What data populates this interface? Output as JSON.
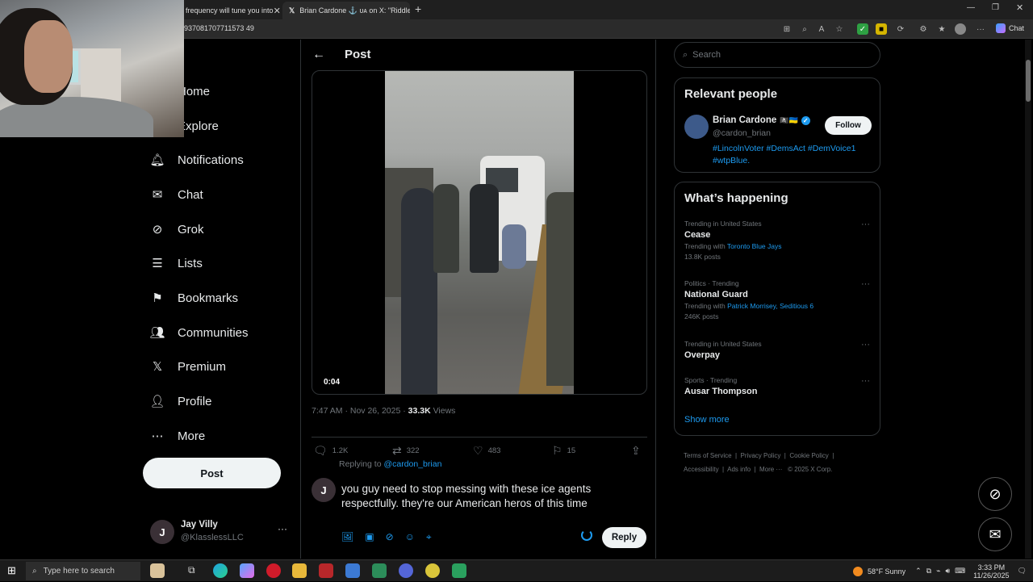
{
  "browser": {
    "tabs": [
      {
        "title": "frequency will tune you into",
        "active": false
      },
      {
        "title": "Brian Cardone ⚓ ᴜᴀ on X: \"Riddle",
        "active": true
      }
    ],
    "url": "937081707711573 49"
  },
  "nav": {
    "items": [
      {
        "label": "Home",
        "icon": "home-icon"
      },
      {
        "label": "Explore",
        "icon": "explore-icon"
      },
      {
        "label": "Notifications",
        "icon": "bell-icon"
      },
      {
        "label": "Chat",
        "icon": "mail-icon"
      },
      {
        "label": "Grok",
        "icon": "grok-icon"
      },
      {
        "label": "Lists",
        "icon": "lists-icon"
      },
      {
        "label": "Bookmarks",
        "icon": "bookmark-icon"
      },
      {
        "label": "Communities",
        "icon": "people-icon"
      },
      {
        "label": "Premium",
        "icon": "x-icon"
      },
      {
        "label": "Profile",
        "icon": "person-icon"
      },
      {
        "label": "More",
        "icon": "more-circle-icon"
      }
    ],
    "post_label": "Post",
    "account": {
      "name": "Jay Villy",
      "handle": "@KlasslessLLC",
      "initial": "J"
    }
  },
  "main": {
    "title": "Post",
    "video_time": "0:04",
    "timestamp": "7:47 AM · Nov 26, 2025 · ",
    "views_count": "33.3K",
    "views_label": " Views",
    "actions": {
      "replies": "1.2K",
      "reposts": "322",
      "likes": "483",
      "bookmarks": "15"
    },
    "replying_prefix": "Replying to ",
    "replying_handle": "@cardon_brian",
    "reply_initial": "J",
    "reply_text": "you guy need to stop messing with these ice agents respectfully. they're our American heros of this time",
    "reply_button": "Reply"
  },
  "right": {
    "search_placeholder": "Search",
    "relevant_title": "Relevant people",
    "person": {
      "name": "Brian Cardone",
      "handle": "@cardon_brian",
      "bio": "#LincolnVoter #DemsAct #DemVoice1 #wtpBlue.",
      "follow_label": "Follow"
    },
    "happening_title": "What’s happening",
    "trends": [
      {
        "meta": "Trending in United States",
        "name": "Cease",
        "with_prefix": "Trending with ",
        "with": "Toronto Blue Jays",
        "posts": "13.8K posts"
      },
      {
        "meta": "Politics · Trending",
        "name": "National Guard",
        "with_prefix": "Trending with ",
        "with": "Patrick Morrisey, Seditious 6",
        "posts": "246K posts"
      },
      {
        "meta": "Trending in United States",
        "name": "Overpay",
        "with_prefix": "",
        "with": "",
        "posts": ""
      },
      {
        "meta": "Sports · Trending",
        "name": "Ausar Thompson",
        "with_prefix": "",
        "with": "",
        "posts": ""
      }
    ],
    "show_more": "Show more",
    "footer": [
      "Terms of Service",
      "Privacy Policy",
      "Cookie Policy",
      "Accessibility",
      "Ads info",
      "More ···",
      "© 2025 X Corp."
    ]
  },
  "taskbar": {
    "search_placeholder": "Type here to search",
    "weather": "58°F  Sunny",
    "time": "3:33 PM",
    "date": "11/26/2025"
  },
  "colors": {
    "accent": "#1d9bf0",
    "bg": "#000000",
    "text": "#e7e9ea",
    "muted": "#71767b"
  }
}
